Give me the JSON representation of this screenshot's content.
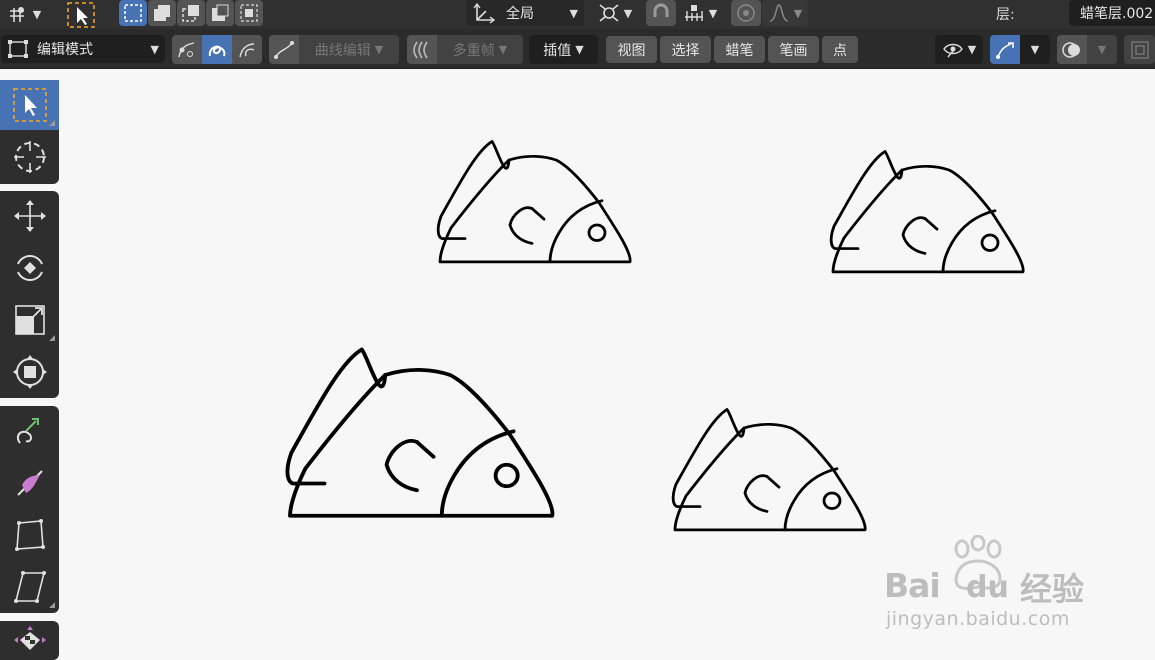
{
  "header": {
    "scope_label": "全局",
    "layer_label": "层:",
    "layer_value": "蜡笔层.002"
  },
  "toolbar": {
    "mode_label": "编辑模式",
    "curve_edit_label": "曲线编辑",
    "multiframe_label": "多重帧",
    "interpolate_label": "插值",
    "menus": [
      "视图",
      "选择",
      "蜡笔",
      "笔画",
      "点"
    ]
  },
  "watermark": {
    "brand_left": "Bai",
    "brand_right": "du",
    "brand_suffix": "经验",
    "url": "jingyan.baidu.com"
  },
  "colors": {
    "accent": "#4772b3",
    "header_bg": "#303030",
    "canvas_bg": "#f7f7f7",
    "stroke": "#000000"
  }
}
